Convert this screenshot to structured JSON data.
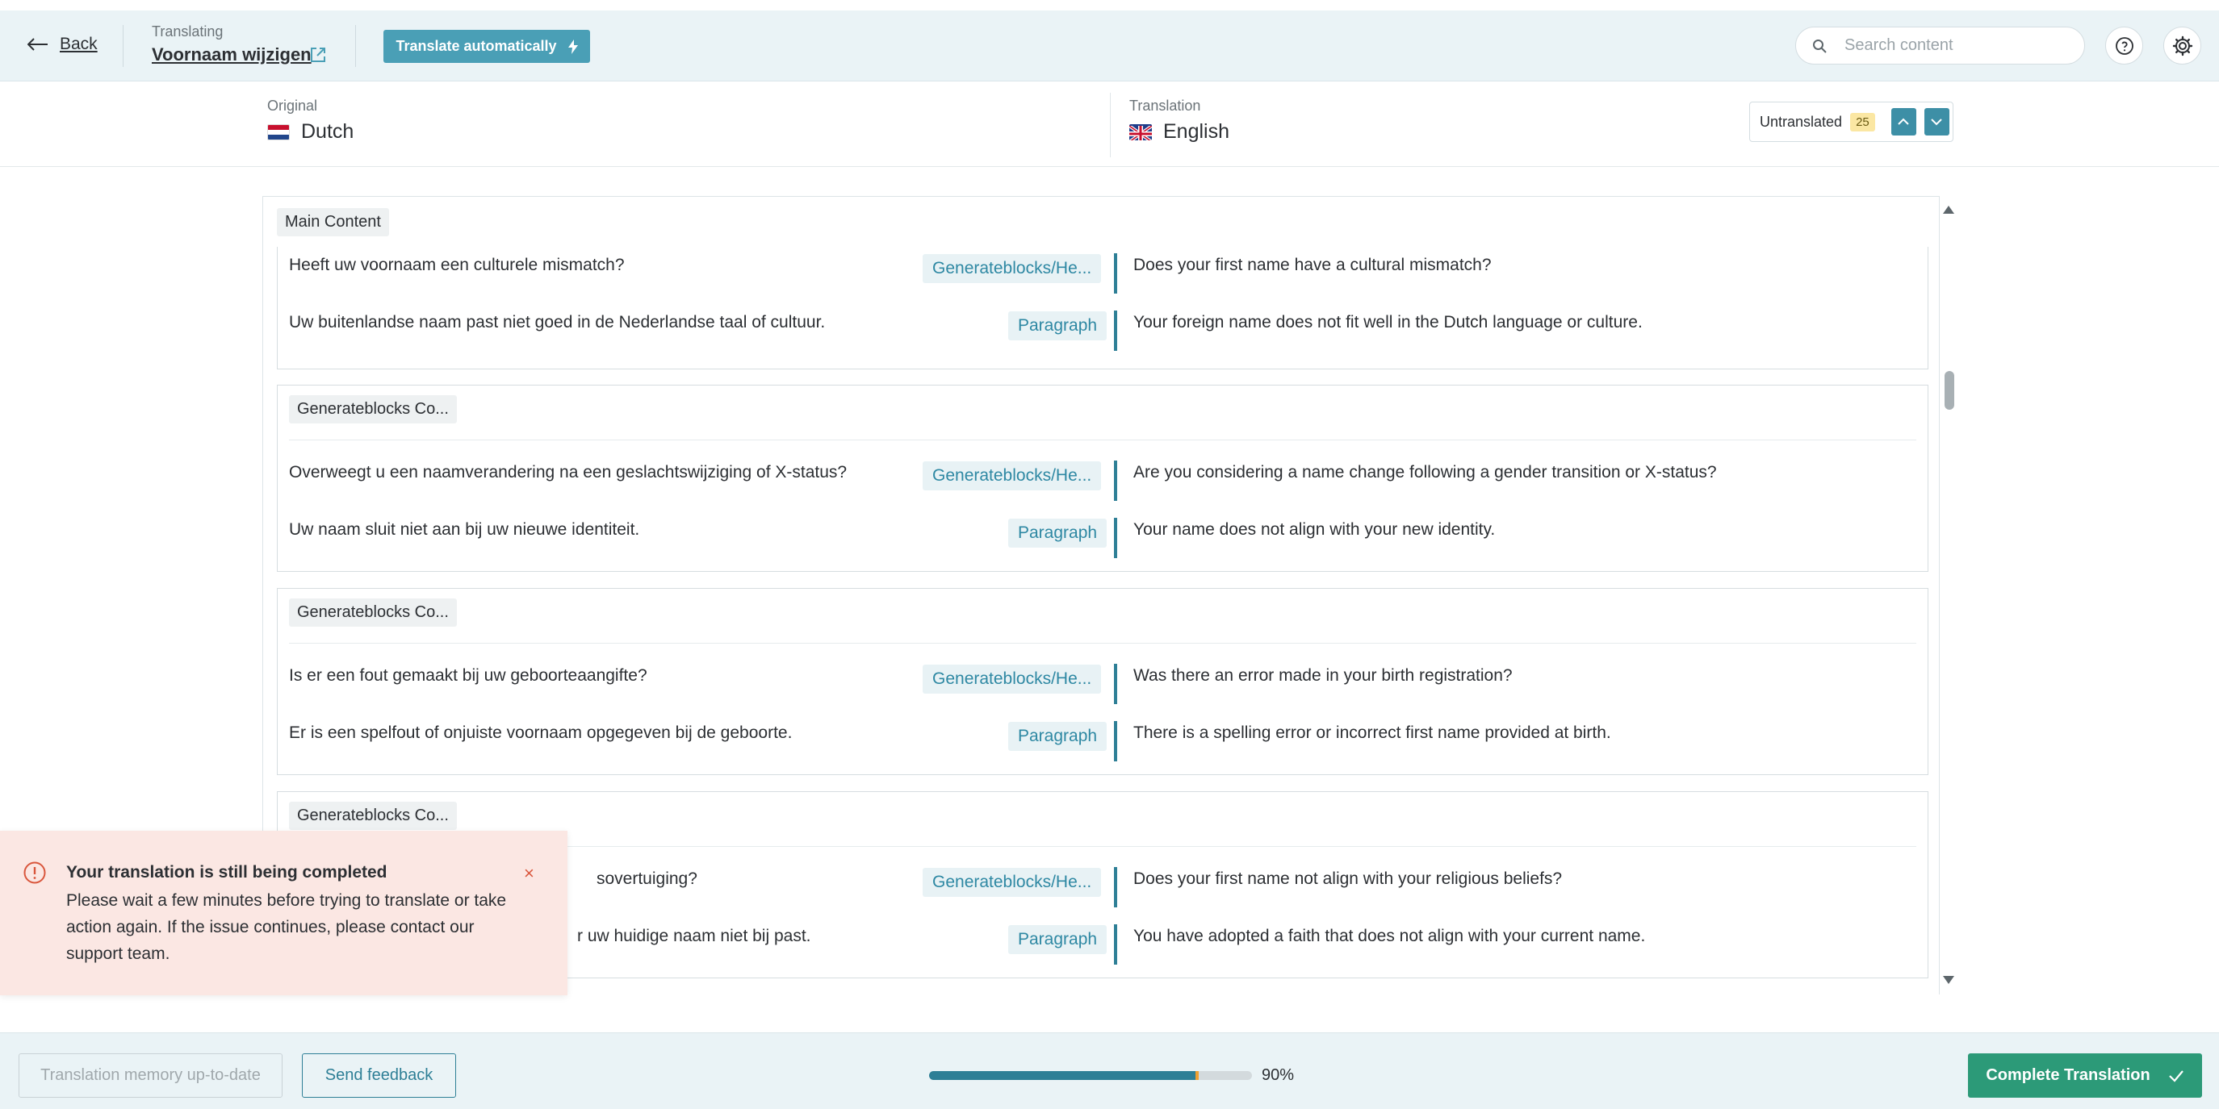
{
  "header": {
    "back_label": "Back",
    "translating_caption": "Translating",
    "document_title": "Voornaam wijzigen",
    "auto_translate_label": "Translate automatically",
    "search_placeholder": "Search content"
  },
  "languages": {
    "original_caption": "Original",
    "original_name": "Dutch",
    "translation_caption": "Translation",
    "translation_name": "English",
    "untranslated_label": "Untranslated",
    "untranslated_count": "25"
  },
  "content": {
    "main_section_label": "Main Content",
    "groups": [
      {
        "label": "",
        "rows": [
          {
            "source": "Heeft uw voornaam een culturele mismatch?",
            "tag": "Generateblocks/He...",
            "target": "Does your first name have a cultural mismatch?"
          },
          {
            "source": "Uw buitenlandse naam past niet goed in de Nederlandse taal of cultuur.",
            "tag": "Paragraph",
            "target": "Your foreign name does not fit well in the Dutch language or culture."
          }
        ]
      },
      {
        "label": "Generateblocks Co...",
        "rows": [
          {
            "source": "Overweegt u een naamverandering na een geslachtswijziging of X-status?",
            "tag": "Generateblocks/He...",
            "target": "Are you considering a name change following a gender transition or X-status?"
          },
          {
            "source": "Uw naam sluit niet aan bij uw nieuwe identiteit.",
            "tag": "Paragraph",
            "target": "Your name does not align with your new identity."
          }
        ]
      },
      {
        "label": "Generateblocks Co...",
        "rows": [
          {
            "source": "Is er een fout gemaakt bij uw geboorteaangifte?",
            "tag": "Generateblocks/He...",
            "target": "Was there an error made in your birth registration?"
          },
          {
            "source": "Er is een spelfout of onjuiste voornaam opgegeven bij de geboorte.",
            "tag": "Paragraph",
            "target": "There is a spelling error or incorrect first name provided at birth."
          }
        ]
      },
      {
        "label": "Generateblocks Co...",
        "rows": [
          {
            "source": "sovertuiging?",
            "tag": "Generateblocks/He...",
            "target": "Does your first name not align with your religious beliefs?"
          },
          {
            "source": "r uw huidige naam niet bij past.",
            "tag": "Paragraph",
            "target": "You have adopted a faith that does not align with your current name."
          }
        ]
      }
    ]
  },
  "toast": {
    "title": "Your translation is still being completed",
    "body": "Please wait a few minutes before trying to translate or take action again. If the issue continues, please contact our support team.",
    "close_glyph": "×"
  },
  "footer": {
    "tm_label": "Translation memory up-to-date",
    "feedback_label": "Send feedback",
    "progress_percent": 90,
    "progress_label": "90%",
    "complete_label": "Complete Translation"
  },
  "colors": {
    "accent": "#2e7f96",
    "auto_button": "#4a9fb6",
    "complete_button": "#2c9a78",
    "toast_bg": "#fbe7e3",
    "progress_tip": "#f0a030"
  }
}
